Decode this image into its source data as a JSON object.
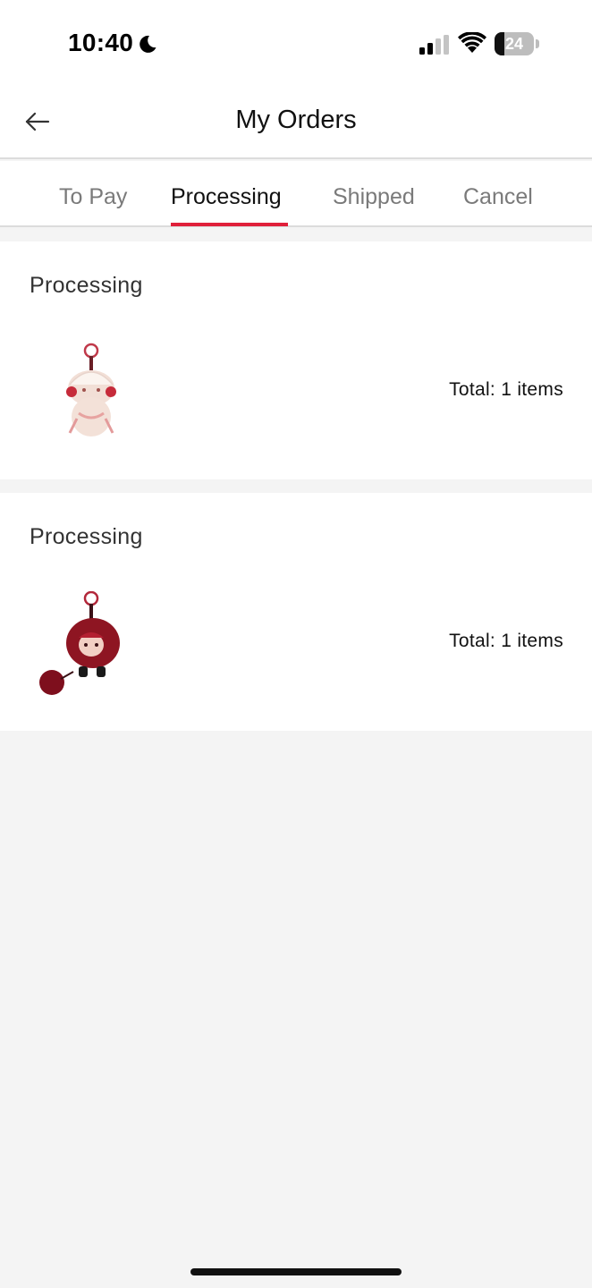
{
  "status_bar": {
    "time": "10:40",
    "battery": "24",
    "icons": [
      "moon-icon",
      "signal-icon",
      "wifi-icon",
      "battery-icon"
    ]
  },
  "header": {
    "title": "My Orders",
    "back_icon": "arrow-left-icon"
  },
  "tabs": [
    {
      "label": "To Pay",
      "active": false
    },
    {
      "label": "Processing",
      "active": true
    },
    {
      "label": "Shipped",
      "active": false
    },
    {
      "label": "Cancel",
      "active": false
    }
  ],
  "orders": [
    {
      "status": "Processing",
      "total": "Total: 1 items",
      "product_image": "cream-plush-doll-keychain"
    },
    {
      "status": "Processing",
      "total": "Total: 1 items",
      "product_image": "red-fluffy-doll-keychain"
    }
  ],
  "colors": {
    "accent": "#e0203a",
    "background": "#f4f4f4",
    "card": "#ffffff",
    "inactive_tab": "#7a7a7a"
  }
}
